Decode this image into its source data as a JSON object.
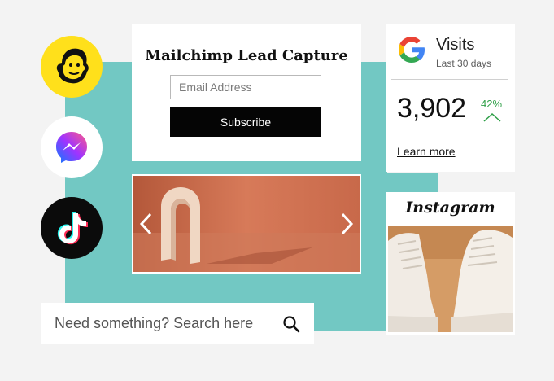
{
  "integrations": [
    {
      "name": "mailchimp",
      "icon": "mailchimp-freddie-icon",
      "bg": "#ffe01b"
    },
    {
      "name": "messenger",
      "icon": "messenger-icon",
      "bg": "#ffffff"
    },
    {
      "name": "tiktok",
      "icon": "tiktok-icon",
      "bg": "#0b0b0b"
    }
  ],
  "lead_capture": {
    "title": "Mailchimp Lead Capture",
    "email_placeholder": "Email Address",
    "subscribe_label": "Subscribe"
  },
  "visits": {
    "title": "Visits",
    "subtitle": "Last 30 days",
    "count": "3,902",
    "change": "42%",
    "learn_more": "Learn more",
    "change_color": "#2e9f47"
  },
  "instagram": {
    "title": "Instagram"
  },
  "search": {
    "placeholder": "Need something? Search here"
  },
  "colors": {
    "accent": "#72c8c3",
    "button": "#050505",
    "background": "#f3f3f3"
  }
}
